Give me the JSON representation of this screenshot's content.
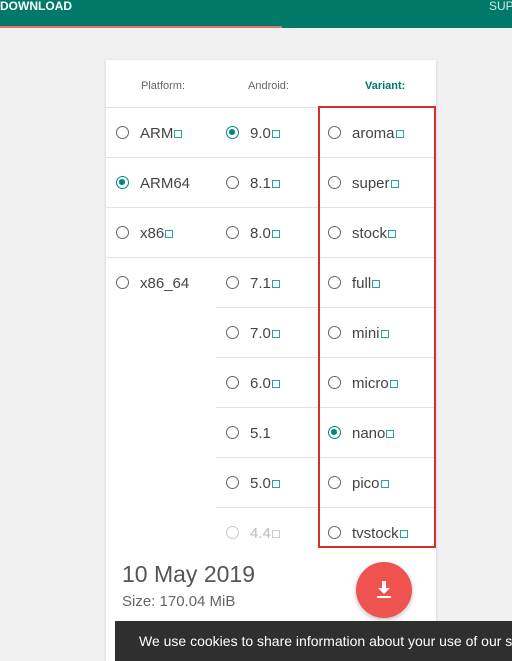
{
  "nav": {
    "tab_download": "DOWNLOAD",
    "tab_support": "SUP"
  },
  "headers": {
    "platform": "Platform:",
    "android": "Android:",
    "variant": "Variant:"
  },
  "platforms": [
    {
      "label": "ARM",
      "checked": false,
      "link": true
    },
    {
      "label": "ARM64",
      "checked": true,
      "link": false
    },
    {
      "label": "x86",
      "checked": false,
      "link": true
    },
    {
      "label": "x86_64",
      "checked": false,
      "link": false
    }
  ],
  "android_versions": [
    {
      "label": "9.0",
      "checked": true,
      "link": true,
      "disabled": false
    },
    {
      "label": "8.1",
      "checked": false,
      "link": true,
      "disabled": false
    },
    {
      "label": "8.0",
      "checked": false,
      "link": true,
      "disabled": false
    },
    {
      "label": "7.1",
      "checked": false,
      "link": true,
      "disabled": false
    },
    {
      "label": "7.0",
      "checked": false,
      "link": true,
      "disabled": false
    },
    {
      "label": "6.0",
      "checked": false,
      "link": true,
      "disabled": false
    },
    {
      "label": "5.1",
      "checked": false,
      "link": false,
      "disabled": false
    },
    {
      "label": "5.0",
      "checked": false,
      "link": true,
      "disabled": false
    },
    {
      "label": "4.4",
      "checked": false,
      "link": true,
      "disabled": true
    }
  ],
  "variants": [
    {
      "label": "aroma",
      "checked": false,
      "link": true
    },
    {
      "label": "super",
      "checked": false,
      "link": true
    },
    {
      "label": "stock",
      "checked": false,
      "link": true
    },
    {
      "label": "full",
      "checked": false,
      "link": true
    },
    {
      "label": "mini",
      "checked": false,
      "link": true
    },
    {
      "label": "micro",
      "checked": false,
      "link": true
    },
    {
      "label": "nano",
      "checked": true,
      "link": true
    },
    {
      "label": "pico",
      "checked": false,
      "link": true
    },
    {
      "label": "tvstock",
      "checked": false,
      "link": true
    }
  ],
  "release": {
    "date": "10 May 2019",
    "size": "Size: 170.04 MiB"
  },
  "cookie_text": "We use cookies to share information about your use of our s",
  "colors": {
    "primary": "#00796b",
    "accent": "#ef5350",
    "highlight_box": "#d32f2f"
  }
}
